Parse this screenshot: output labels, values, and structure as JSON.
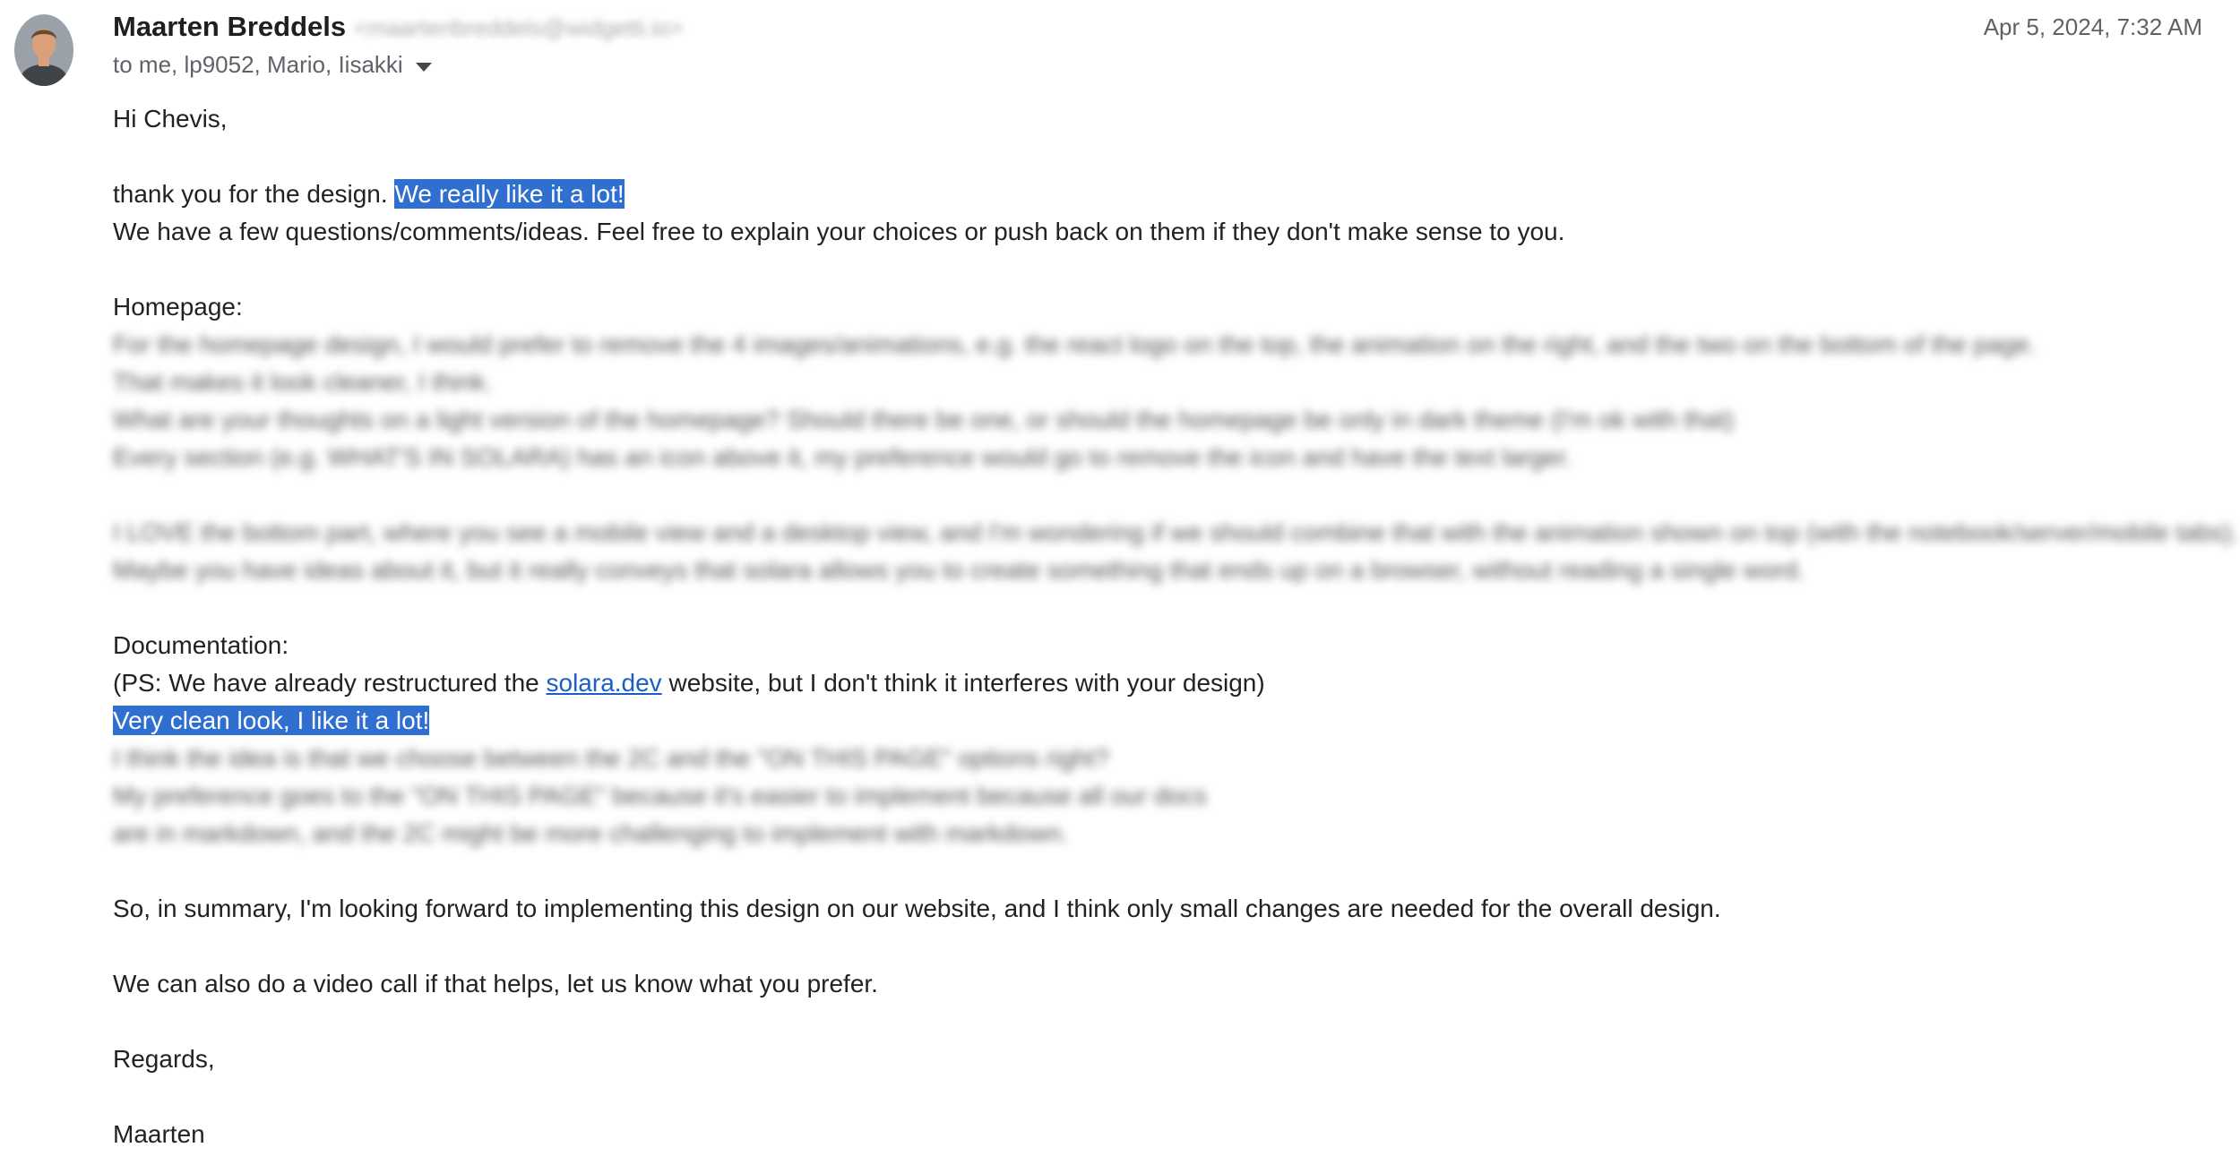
{
  "header": {
    "sender_name": "Maarten Breddels",
    "sender_email": "<maartenbreddels@widgetti.io>",
    "timestamp": "Apr 5, 2024, 7:32 AM",
    "recipients": "to me, lp9052, Mario, Iisakki"
  },
  "avatar": {
    "icon": "person-avatar-photo",
    "colors": {
      "background": "#9aa1a8",
      "skin": "#d9a07a",
      "hair": "#6b4a32",
      "shirt": "#3f4448"
    }
  },
  "colors": {
    "selection": "#2f6fd0",
    "link": "#1a5ec8"
  },
  "body": {
    "greeting": "Hi Chevis,",
    "thanks_plain": "thank you for the design. ",
    "thanks_highlight": "We really like it a lot!",
    "intro": "We have a few questions/comments/ideas. Feel free to explain your choices or push back on them if they don't make sense to you.",
    "homepage_heading": "Homepage:",
    "homepage_blurred": [
      "For the homepage design, I would prefer to remove the 4 images/animations, e.g. the react logo on the top, the animation on the right, and the two on the bottom of the page.",
      "That makes it look cleaner, I think.",
      "What are your thoughts on a light version of the homepage? Should there be one, or should the homepage be only in dark theme (I'm ok with that)",
      "Every section (e.g. WHAT'S IN SOLARA) has an icon above it, my preference would go to remove the icon and have the text larger."
    ],
    "homepage_blurred_2": [
      "I LOVE the bottom part, where you see a mobile view and a desktop view, and I'm wondering if we should combine that with the animation shown on top (with the notebook/server/mobile tabs).",
      "Maybe you have ideas about it, but it really conveys that solara allows you to create something that ends up on a browser, without reading a single word."
    ],
    "documentation_heading": "Documentation:",
    "ps_before": "(PS: We have already restructured the ",
    "ps_link": "solara.dev",
    "ps_after": " website, but I don't think it interferes with your design)",
    "doc_highlight": "Very clean look, I like it a lot!",
    "doc_blurred": [
      "I think the idea is that we choose between the 2C and the \"ON THIS PAGE\" options right?",
      "My preference goes to the \"ON THIS PAGE\" because it's easier to implement because all our docs",
      "are in markdown, and the 2C might be more challenging to implement with markdown."
    ],
    "summary": "So, in summary, I'm looking forward to implementing this design on our website, and I think only small changes are needed for the overall design.",
    "video_call": "We can also do a video call if that helps, let us know what you prefer.",
    "closing": "Regards,",
    "signature": "Maarten"
  }
}
